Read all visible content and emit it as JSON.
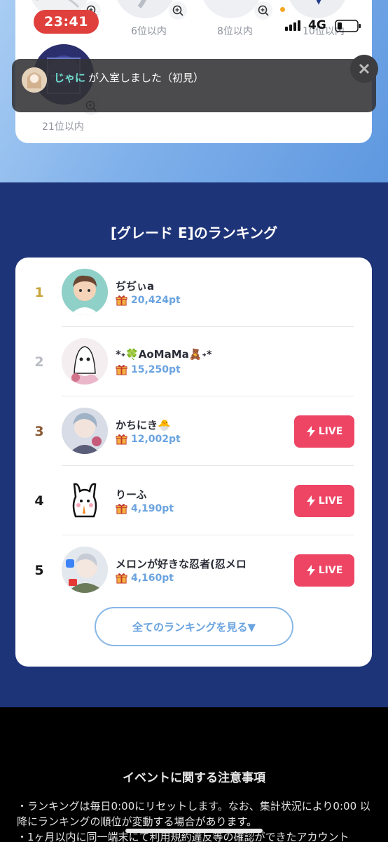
{
  "status_bar": {
    "time": "23:41",
    "network": "4G"
  },
  "top_rankings": [
    {
      "caption": "6位以内"
    },
    {
      "caption": "8位以内"
    },
    {
      "caption": "10位以内"
    },
    {
      "caption": "21位以内"
    }
  ],
  "toast": {
    "user_name": "じゃに",
    "message": "が入室しました（初見）"
  },
  "ranking": {
    "title": "[グレード E]のランキング",
    "items": [
      {
        "rank": "1",
        "name": "ぢぢぃa",
        "points": "20,424pt",
        "live": false,
        "rank_color": "#c9a43a"
      },
      {
        "rank": "2",
        "name": "*˖🍀AoMaMa🧸˖*",
        "points": "15,250pt",
        "live": false,
        "rank_color": "#b9bcc2"
      },
      {
        "rank": "3",
        "name": "かちにき🐣",
        "points": "12,002pt",
        "live": true,
        "rank_color": "#8a5a35"
      },
      {
        "rank": "4",
        "name": "りーふ",
        "points": "4,190pt",
        "live": true,
        "rank_color": "#1a1a1a"
      },
      {
        "rank": "5",
        "name": "メロンが好きな忍者(忍メロ",
        "points": "4,160pt",
        "live": true,
        "rank_color": "#1a1a1a"
      }
    ],
    "live_label": "LIVE",
    "view_all_label": "全てのランキングを見る▼"
  },
  "notes": {
    "title": "イベントに関する注意事項",
    "lines": [
      "・ランキングは毎日0:00にリセットします。なお、集計状況により0:00 以降にランキングの順位が変動する場合があります。",
      "・1ヶ月以内に同一端末にて利用規約違反等の確認ができたアカウント"
    ]
  },
  "colors": {
    "top_gradient_start": "#a9cdf3",
    "top_gradient_end": "#5f98e0",
    "ranking_bg": "#1e3479",
    "live_button": "#ee4565",
    "accent_blue": "#6aa3df",
    "toast_name": "#6fe0d0"
  },
  "icons": {
    "zoom": "zoom-in-icon",
    "gift": "gift-icon",
    "live": "lightning-icon",
    "close": "close-icon"
  }
}
